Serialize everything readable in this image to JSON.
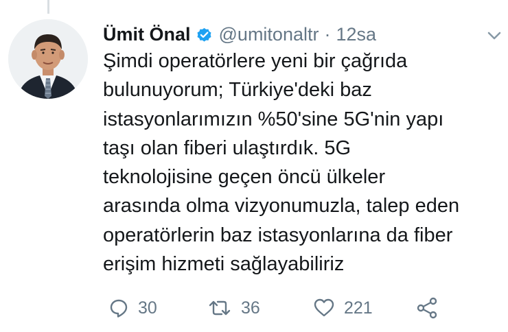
{
  "tweet": {
    "author": {
      "display_name": "Ümit Önal",
      "handle": "@umitonaltr",
      "verified": true,
      "avatar_icon": "profile-photo"
    },
    "separator": "·",
    "time": "12sa",
    "text": "Şimdi operatörlere yeni bir çağrıda\nbulunuyorum; Türkiye'deki baz\nistasyonlarımızın %50'sine 5G'nin yapı\ntaşı olan fiberi ulaştırdık. 5G\nteknolojisine geçen öncü ülkeler\narasında olma vizyonumuzla, talep eden\noperatörlerin baz istasyonlarına da fiber\nerişim hizmeti sağlayabiliriz",
    "actions": {
      "replies": "30",
      "retweets": "36",
      "likes": "221"
    },
    "icons": {
      "reply": "reply-icon",
      "retweet": "retweet-icon",
      "like": "heart-icon",
      "share": "share-icon",
      "menu": "chevron-down-icon",
      "verified": "verified-badge-icon"
    }
  },
  "colors": {
    "text_primary": "#14171a",
    "text_secondary": "#657786",
    "verified_blue": "#1da1f2",
    "thread_line": "#d9dee2"
  }
}
